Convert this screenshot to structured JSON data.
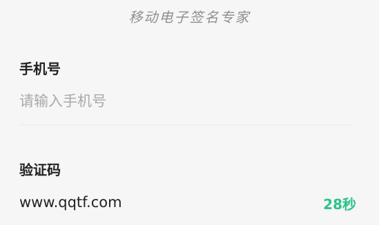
{
  "header": {
    "watermark_title": "移动电子签名专家"
  },
  "form": {
    "phone": {
      "label": "手机号",
      "value": "",
      "placeholder": "请输入手机号"
    },
    "code": {
      "label": "验证码",
      "value": "www.qqtf.com",
      "countdown_label": "28秒"
    }
  },
  "colors": {
    "background": "#f6f6f6",
    "accent": "#2bc48a",
    "placeholder": "#a9a9a9",
    "text": "#222222"
  }
}
